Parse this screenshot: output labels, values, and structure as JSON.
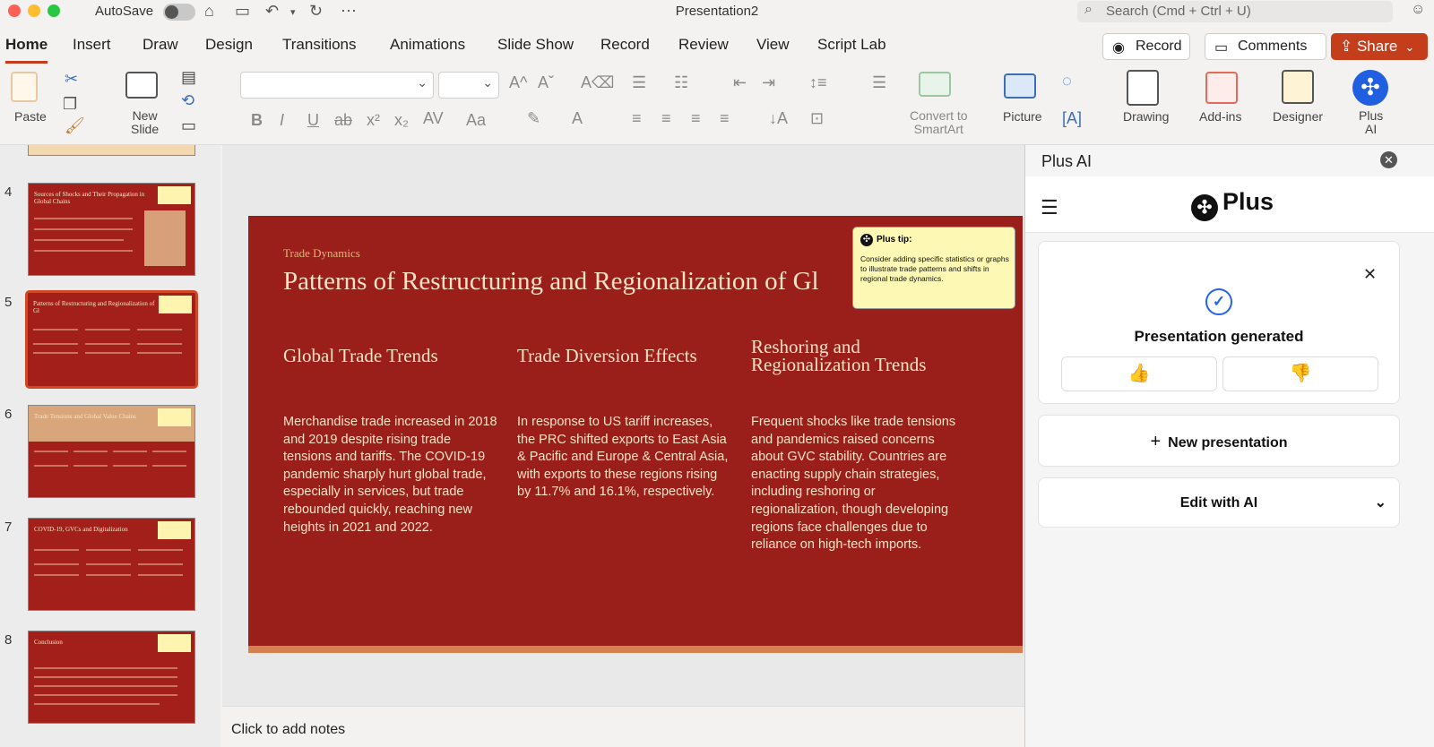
{
  "app": {
    "autosave_label": "AutoSave",
    "doc_title": "Presentation2",
    "search_placeholder": "Search (Cmd + Ctrl + U)"
  },
  "tabs": [
    "Home",
    "Insert",
    "Draw",
    "Design",
    "Transitions",
    "Animations",
    "Slide Show",
    "Record",
    "Review",
    "View",
    "Script Lab"
  ],
  "actions": {
    "record": "Record",
    "comments": "Comments",
    "share": "Share"
  },
  "ribbon": {
    "paste": "Paste",
    "new_slide": "New\nSlide",
    "convert": "Convert to\nSmartArt",
    "picture": "Picture",
    "drawing": "Drawing",
    "addins": "Add-ins",
    "designer": "Designer",
    "plus_ai": "Plus\nAI"
  },
  "thumbnails": [
    {
      "num": "4",
      "title": "Sources of Shocks and Their Propagation in Global Chains"
    },
    {
      "num": "5",
      "title": "Patterns of Restructuring and Regionalization of Gl",
      "selected": true
    },
    {
      "num": "6",
      "title": "Trade Tensions and Global Value Chains"
    },
    {
      "num": "7",
      "title": "COVID-19, GVCs and Digitalization"
    },
    {
      "num": "8",
      "title": "Conclusion"
    }
  ],
  "slide": {
    "kicker": "Trade Dynamics",
    "title": "Patterns of Restructuring and Regionalization of Gl",
    "columns": [
      {
        "heading": "Global Trade Trends",
        "body": "Merchandise trade increased in 2018 and 2019 despite rising trade tensions and tariffs. The COVID-19 pandemic sharply hurt global trade, especially in services, but trade rebounded quickly, reaching new heights in 2021 and 2022."
      },
      {
        "heading": "Trade Diversion Effects",
        "body": "In response to US tariff increases, the PRC shifted exports to East Asia & Pacific and Europe & Central Asia, with exports to these regions rising by 11.7% and 16.1%, respectively."
      },
      {
        "heading": "Reshoring and Regionalization Trends",
        "body": "Frequent shocks like trade tensions and pandemics raised concerns about GVC stability. Countries are enacting supply chain strategies, including reshoring or regionalization, though developing regions face challenges due to reliance on high-tech imports."
      }
    ],
    "tip_title": "Plus tip:",
    "tip_body": "Consider adding specific statistics or graphs to illustrate trade patterns and shifts in regional trade dynamics."
  },
  "notes": "Click to add notes",
  "panel": {
    "title": "Plus AI",
    "brand": "Plus",
    "status": "Presentation generated",
    "new_presentation": "New presentation",
    "edit_with_ai": "Edit with AI"
  },
  "colors": {
    "accent": "#c43e1c",
    "slide_bg": "#9a1f1b",
    "slide_text": "#fbe3c5"
  }
}
